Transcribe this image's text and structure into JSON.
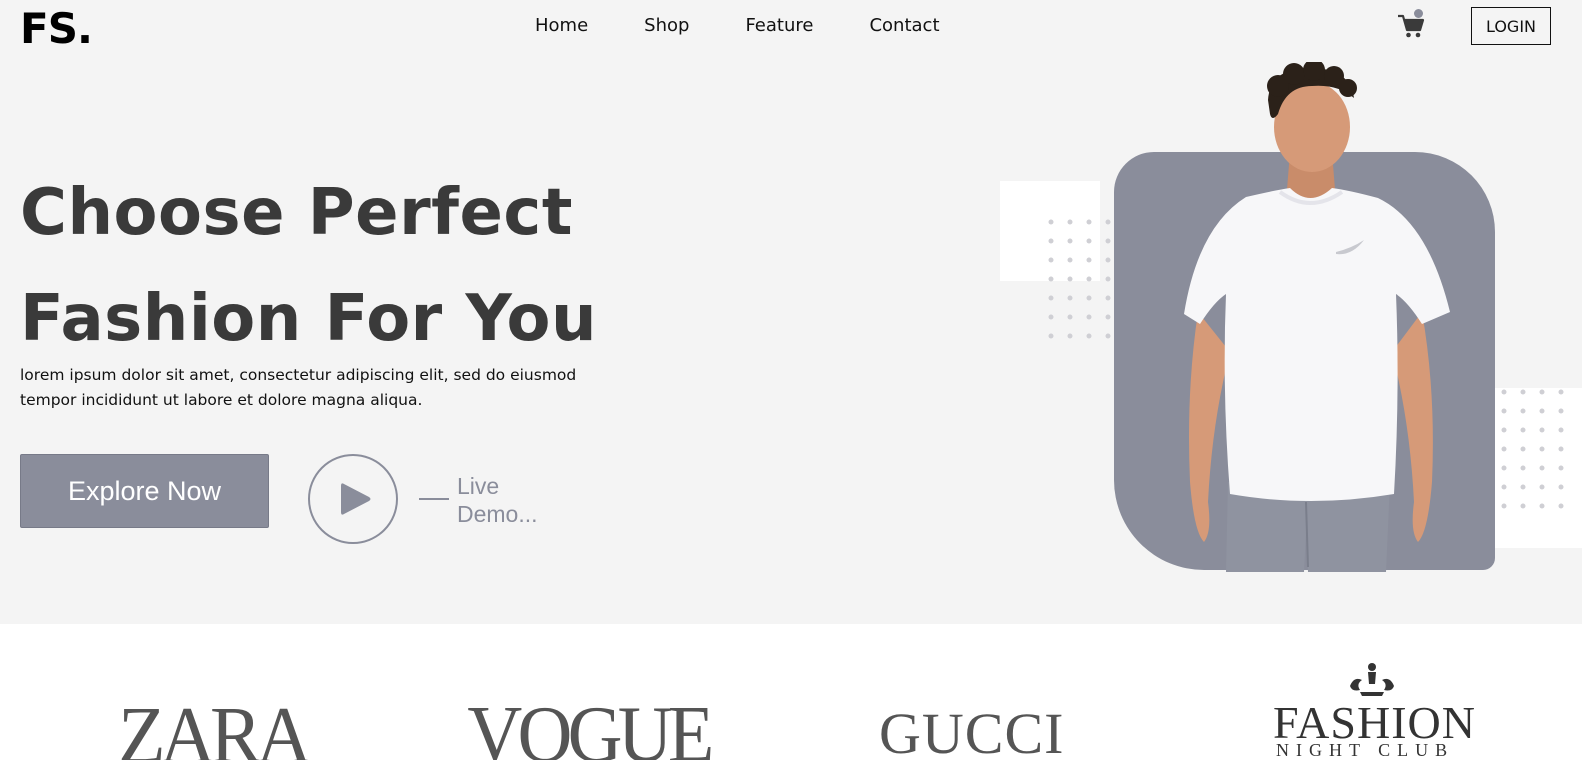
{
  "header": {
    "logo": "FS.",
    "nav": [
      "Home",
      "Shop",
      "Feature",
      "Contact"
    ],
    "cart_icon": "cart-icon",
    "login_label": "LOGIN"
  },
  "hero": {
    "title_line1": "Choose Perfect",
    "title_line2": "Fashion For You",
    "description": "lorem ipsum dolor sit amet, consectetur adipiscing elit, sed do eiusmod tempor incididunt ut labore et dolore magna aliqua.",
    "explore_label": "Explore Now",
    "play_icon": "play-icon",
    "live_demo_label": "Live Demo...",
    "accent_color": "#8a8d9b"
  },
  "brands": {
    "zara": "ZARA",
    "vogue": "VOGUE",
    "gucci": "GUCCI",
    "fashion": "FASHION",
    "nightclub": "NIGHT CLUB"
  }
}
